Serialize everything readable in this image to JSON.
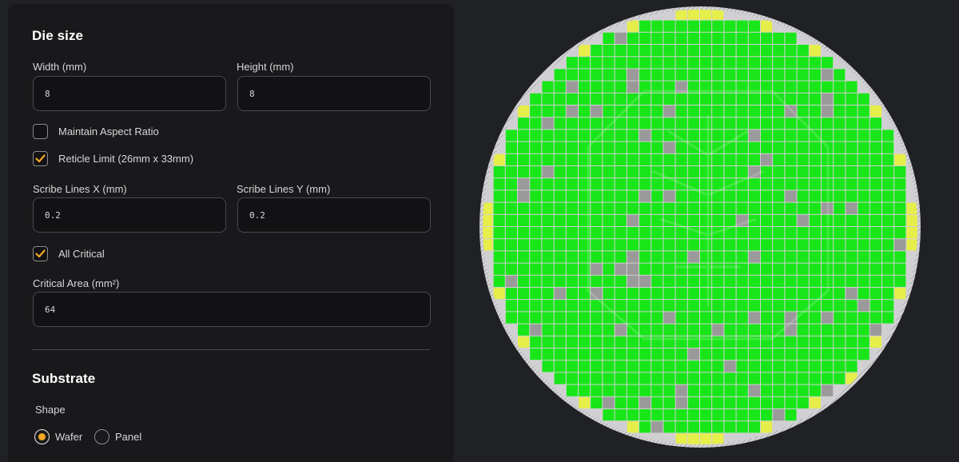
{
  "die_size": {
    "title": "Die size",
    "width_label": "Width (mm)",
    "width_value": "8",
    "height_label": "Height (mm)",
    "height_value": "8",
    "maintain_aspect_label": "Maintain Aspect Ratio",
    "maintain_aspect_checked": false,
    "reticle_label": "Reticle Limit (26mm x 33mm)",
    "reticle_checked": true,
    "scribe_x_label": "Scribe Lines X (mm)",
    "scribe_x_value": "0.2",
    "scribe_y_label": "Scribe Lines Y (mm)",
    "scribe_y_value": "0.2",
    "all_critical_label": "All Critical",
    "all_critical_checked": true,
    "critical_area_label": "Critical Area (mm²)",
    "critical_area_value": "64"
  },
  "substrate": {
    "title": "Substrate",
    "shape_label": "Shape",
    "options": [
      "Wafer",
      "Panel"
    ],
    "selected": "Wafer"
  },
  "colors": {
    "accent": "#f5a623",
    "good_die": "#19e619",
    "defect_die": "#9a9a9a",
    "partial_die": "#e6ee4a",
    "edge": "#cfcfd2"
  }
}
